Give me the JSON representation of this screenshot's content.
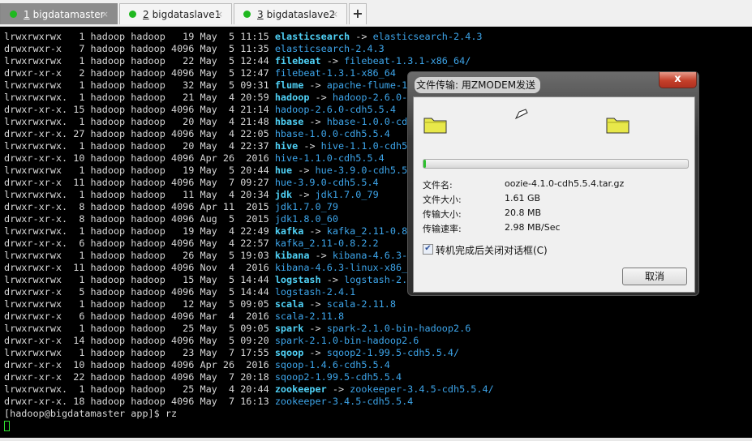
{
  "tabs": [
    {
      "num": "1",
      "label": "bigdatamaster",
      "close": "×"
    },
    {
      "num": "2",
      "label": "bigdataslave1",
      "close": "×"
    },
    {
      "num": "3",
      "label": "bigdataslave2",
      "close": "×"
    }
  ],
  "new_tab": "+",
  "lines": [
    {
      "p": "lrwxrwxrwx   1 hadoop hadoop   19 May  5 11:15 ",
      "n": "elasticsearch",
      "t": "elasticsearch-2.4.3"
    },
    {
      "p": "drwxrwxr-x   7 hadoop hadoop 4096 May  5 11:35 ",
      "d": "elasticsearch-2.4.3"
    },
    {
      "p": "lrwxrwxrwx   1 hadoop hadoop   22 May  5 12:44 ",
      "n": "filebeat",
      "t": "filebeat-1.3.1-x86_64/"
    },
    {
      "p": "drwxr-xr-x   2 hadoop hadoop 4096 May  5 12:47 ",
      "d": "filebeat-1.3.1-x86_64"
    },
    {
      "p": "lrwxrwxrwx   1 hadoop hadoop   32 May  5 09:31 ",
      "n": "flume",
      "t": "apache-flume-1."
    },
    {
      "p": "lrwxrwxrwx.  1 hadoop hadoop   21 May  4 20:59 ",
      "n": "hadoop",
      "t": "hadoop-2.6.0-c"
    },
    {
      "p": "drwxr-xr-x. 15 hadoop hadoop 4096 May  4 21:14 ",
      "d": "hadoop-2.6.0-cdh5.5.4"
    },
    {
      "p": "lrwxrwxrwx.  1 hadoop hadoop   20 May  4 21:48 ",
      "n": "hbase",
      "t": "hbase-1.0.0-cdh"
    },
    {
      "p": "drwxr-xr-x. 27 hadoop hadoop 4096 May  4 22:05 ",
      "d": "hbase-1.0.0-cdh5.5.4"
    },
    {
      "p": "lrwxrwxrwx.  1 hadoop hadoop   20 May  4 22:37 ",
      "n": "hive",
      "t": "hive-1.1.0-cdh5."
    },
    {
      "p": "drwxr-xr-x. 10 hadoop hadoop 4096 Apr 26  2016 ",
      "d": "hive-1.1.0-cdh5.5.4"
    },
    {
      "p": "lrwxrwxrwx   1 hadoop hadoop   19 May  5 20:44 ",
      "n": "hue",
      "t": "hue-3.9.0-cdh5.5."
    },
    {
      "p": "drwxr-xr-x  11 hadoop hadoop 4096 May  7 09:27 ",
      "d": "hue-3.9.0-cdh5.5.4"
    },
    {
      "p": "lrwxrwxrwx.  1 hadoop hadoop   11 May  4 20:34 ",
      "n": "jdk",
      "t": "jdk1.7.0_79"
    },
    {
      "p": "drwxr-xr-x.  8 hadoop hadoop 4096 Apr 11  2015 ",
      "d": "jdk1.7.0_79"
    },
    {
      "p": "drwxr-xr-x.  8 hadoop hadoop 4096 Aug  5  2015 ",
      "d": "jdk1.8.0_60"
    },
    {
      "p": "lrwxrwxrwx.  1 hadoop hadoop   19 May  4 22:49 ",
      "n": "kafka",
      "t": "kafka_2.11-0.8."
    },
    {
      "p": "drwxr-xr-x.  6 hadoop hadoop 4096 May  4 22:57 ",
      "d": "kafka_2.11-0.8.2.2"
    },
    {
      "p": "lrwxrwxrwx   1 hadoop hadoop   26 May  5 19:03 ",
      "n": "kibana",
      "t": "kibana-4.6.3-l"
    },
    {
      "p": "drwxrwxr-x  11 hadoop hadoop 4096 Nov  4  2016 ",
      "d": "kibana-4.6.3-linux-x86_6"
    },
    {
      "p": "lrwxrwxrwx   1 hadoop hadoop   15 May  5 14:44 ",
      "n": "logstash",
      "t": "logstash-2.4"
    },
    {
      "p": "drwxrwxr-x   5 hadoop hadoop 4096 May  5 14:44 ",
      "d": "logstash-2.4.1"
    },
    {
      "p": "lrwxrwxrwx   1 hadoop hadoop   12 May  5 09:05 ",
      "n": "scala",
      "t": "scala-2.11.8"
    },
    {
      "p": "drwxrwxr-x   6 hadoop hadoop 4096 Mar  4  2016 ",
      "d": "scala-2.11.8"
    },
    {
      "p": "lrwxrwxrwx   1 hadoop hadoop   25 May  5 09:05 ",
      "n": "spark",
      "t": "spark-2.1.0-bin-hadoop2.6"
    },
    {
      "p": "drwxr-xr-x  14 hadoop hadoop 4096 May  5 09:20 ",
      "d": "spark-2.1.0-bin-hadoop2.6"
    },
    {
      "p": "lrwxrwxrwx   1 hadoop hadoop   23 May  7 17:55 ",
      "n": "sqoop",
      "t": "sqoop2-1.99.5-cdh5.5.4/"
    },
    {
      "p": "drwxr-xr-x  10 hadoop hadoop 4096 Apr 26  2016 ",
      "d": "sqoop-1.4.6-cdh5.5.4"
    },
    {
      "p": "drwxr-xr-x  22 hadoop hadoop 4096 May  7 20:18 ",
      "d": "sqoop2-1.99.5-cdh5.5.4"
    },
    {
      "p": "lrwxrwxrwx.  1 hadoop hadoop   25 May  4 20:44 ",
      "n": "zookeeper",
      "t": "zookeeper-3.4.5-cdh5.5.4/"
    },
    {
      "p": "drwxr-xr-x. 18 hadoop hadoop 4096 May  7 16:13 ",
      "d": "zookeeper-3.4.5-cdh5.5.4"
    }
  ],
  "arrow": " -> ",
  "prompt": "[hadoop@bigdatamaster app]$ rz",
  "dialog": {
    "title": "文件传输: 用ZMODEM发送",
    "close": "x",
    "progress_percent": 1,
    "fields": [
      {
        "label": "文件名:",
        "value": "oozie-4.1.0-cdh5.5.4.tar.gz"
      },
      {
        "label": "文件大小:",
        "value": "1.61 GB"
      },
      {
        "label": "传输大小:",
        "value": "20.8 MB"
      },
      {
        "label": "传输速率:",
        "value": "2.98 MB/Sec"
      }
    ],
    "checkbox_label": "转机完成后关闭对话框(C)",
    "checkbox_checked": true,
    "cancel": "取消"
  }
}
